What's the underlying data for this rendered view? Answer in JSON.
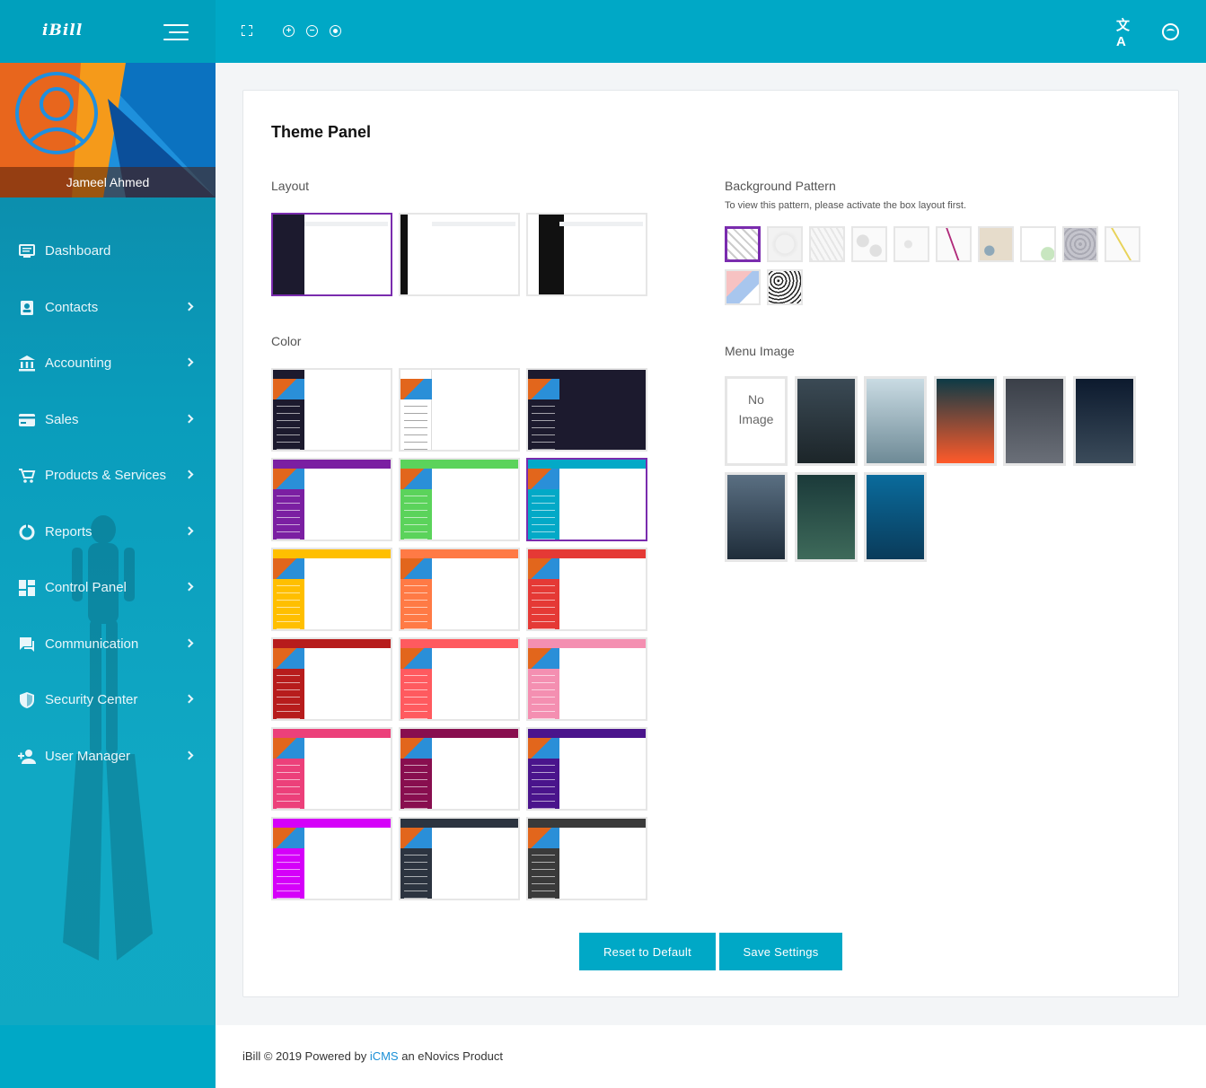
{
  "brand": {
    "logo": "iBill"
  },
  "topbar": {
    "icons": [
      "fullscreen-icon",
      "zoom-in-icon",
      "zoom-out-icon",
      "zoom-reset-icon",
      "translate-icon",
      "user-face-icon"
    ],
    "zoom_in_glyph": "+",
    "zoom_out_glyph": "−",
    "translate_glyph": "文A"
  },
  "profile": {
    "name": "Jameel Ahmed"
  },
  "sidebar": {
    "items": [
      {
        "label": "Dashboard",
        "icon": "monitor-icon",
        "has_children": false
      },
      {
        "label": "Contacts",
        "icon": "contact-card-icon",
        "has_children": true
      },
      {
        "label": "Accounting",
        "icon": "bank-icon",
        "has_children": true
      },
      {
        "label": "Sales",
        "icon": "credit-card-icon",
        "has_children": true
      },
      {
        "label": "Products & Services",
        "icon": "cart-icon",
        "has_children": true
      },
      {
        "label": "Reports",
        "icon": "donut-chart-icon",
        "has_children": true
      },
      {
        "label": "Control Panel",
        "icon": "dashboard-grid-icon",
        "has_children": true
      },
      {
        "label": "Communication",
        "icon": "chat-icon",
        "has_children": true
      },
      {
        "label": "Security Center",
        "icon": "shield-icon",
        "has_children": true
      },
      {
        "label": "User Manager",
        "icon": "add-user-icon",
        "has_children": true
      }
    ]
  },
  "panel": {
    "title": "Theme Panel",
    "layout": {
      "label": "Layout",
      "selected_index": 0
    },
    "color": {
      "label": "Color",
      "selected_index": 5,
      "options": [
        {
          "sidebar": "#1c1a2e",
          "header": "#1c1a2e",
          "body": "#ffffff"
        },
        {
          "sidebar": "#ffffff",
          "header": "#1c1a2e",
          "body": "#ffffff"
        },
        {
          "sidebar": "#1c1a2e",
          "header": "#1c1a2e",
          "body": "#1c1a2e"
        },
        {
          "sidebar": "#7b1fa2",
          "header": "#7b1fa2",
          "body": "#ffffff"
        },
        {
          "sidebar": "#5bd35b",
          "header": "#5bd35b",
          "body": "#ffffff"
        },
        {
          "sidebar": "#03a9c7",
          "header": "#03a9c7",
          "body": "#ffffff"
        },
        {
          "sidebar": "#ffbf00",
          "header": "#ffbf00",
          "body": "#ffffff"
        },
        {
          "sidebar": "#ff7a45",
          "header": "#ff7a45",
          "body": "#ffffff"
        },
        {
          "sidebar": "#e53935",
          "header": "#e53935",
          "body": "#ffffff"
        },
        {
          "sidebar": "#b71c1c",
          "header": "#b71c1c",
          "body": "#ffffff"
        },
        {
          "sidebar": "#ff5a5f",
          "header": "#ff5a5f",
          "body": "#ffffff"
        },
        {
          "sidebar": "#f48fb1",
          "header": "#f48fb1",
          "body": "#ffffff"
        },
        {
          "sidebar": "#ec407a",
          "header": "#ec407a",
          "body": "#ffffff"
        },
        {
          "sidebar": "#880e4f",
          "header": "#880e4f",
          "body": "#ffffff"
        },
        {
          "sidebar": "#4a148c",
          "header": "#4a148c",
          "body": "#ffffff"
        },
        {
          "sidebar": "#d500f9",
          "header": "#d500f9",
          "body": "#ffffff"
        },
        {
          "sidebar": "#2c3440",
          "header": "#2c3440",
          "body": "#ffffff"
        },
        {
          "sidebar": "#3a3a3a",
          "header": "#3a3a3a",
          "body": "#ffffff"
        }
      ]
    },
    "background_pattern": {
      "label": "Background Pattern",
      "hint": "To view this pattern, please activate the box layout first.",
      "selected_index": 0,
      "count": 12
    },
    "menu_image": {
      "label": "Menu Image",
      "no_image_line1": "No",
      "no_image_line2": "Image",
      "selected_index": 9,
      "images": [
        {
          "name": "no-image",
          "colors": []
        },
        {
          "name": "rain-drops-image",
          "colors": [
            "#3b4a55",
            "#1c2529"
          ]
        },
        {
          "name": "misty-forest-image",
          "colors": [
            "#c9dbe3",
            "#6e8a96"
          ]
        },
        {
          "name": "sunset-coast-image",
          "colors": [
            "#0d3a46",
            "#ff5a2a"
          ]
        },
        {
          "name": "city-street-image",
          "colors": [
            "#3a3f48",
            "#6a6f78"
          ]
        },
        {
          "name": "night-sky-image",
          "colors": [
            "#0c1a2e",
            "#3b4b5a"
          ]
        },
        {
          "name": "ocean-waves-image",
          "colors": [
            "#5a6f82",
            "#1f2d3a"
          ]
        },
        {
          "name": "bokeh-lights-image",
          "colors": [
            "#1b3a3a",
            "#3e6a5a"
          ]
        },
        {
          "name": "underwater-diver-image",
          "colors": [
            "#0a6b9c",
            "#0a3b5a"
          ]
        }
      ]
    },
    "buttons": {
      "reset": "Reset to Default",
      "save": "Save Settings"
    }
  },
  "footer": {
    "prefix": "iBill © 2019 Powered by ",
    "link": "iCMS",
    "suffix": " an eNovics Product"
  },
  "colors": {
    "accent": "#00a8c6",
    "selected_border": "#7a2cae",
    "link": "#1a8fd6"
  }
}
